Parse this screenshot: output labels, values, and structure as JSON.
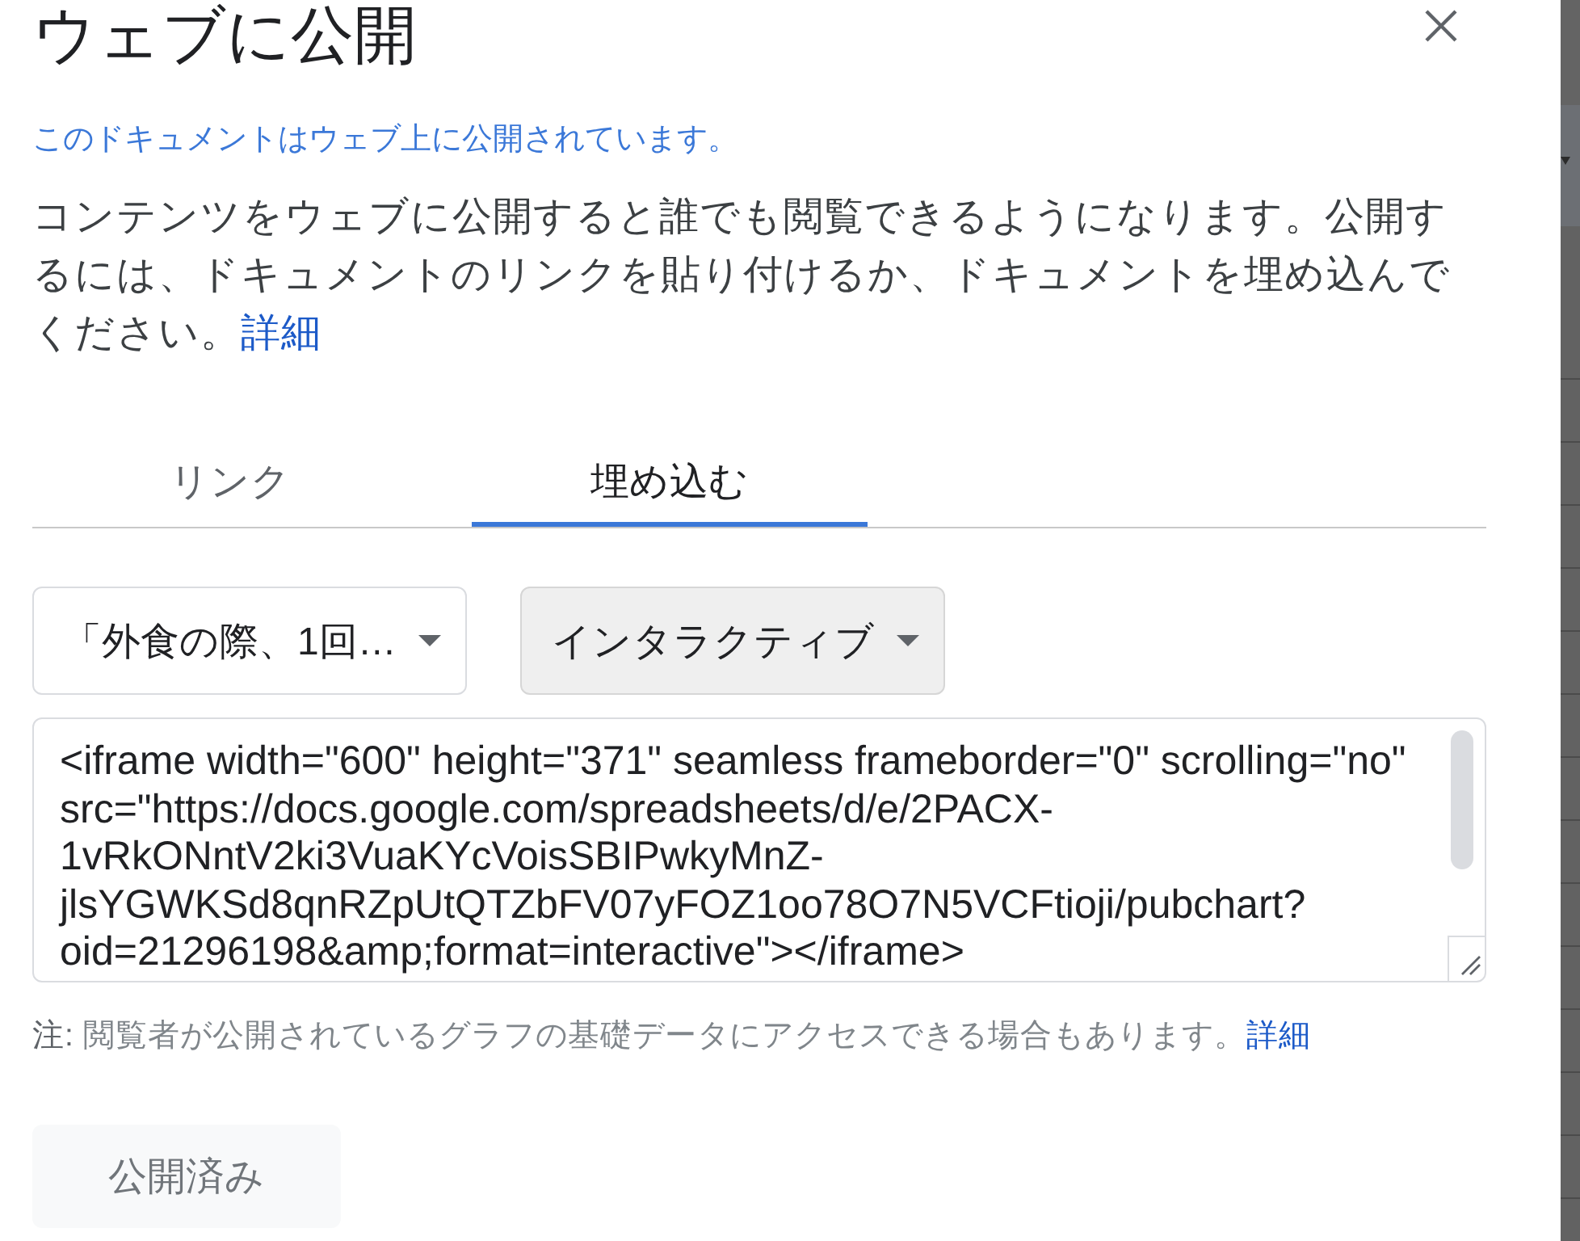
{
  "title": "ウェブに公開",
  "status": "このドキュメントはウェブ上に公開されています。",
  "description": {
    "text": "コンテンツをウェブに公開すると誰でも閲覧できるようになります。公開するには、ドキュメントのリンクを貼り付けるか、ドキュメントを埋め込んでください。",
    "link": "詳細"
  },
  "tabs": [
    {
      "label": "リンク",
      "selected": false
    },
    {
      "label": "埋め込む",
      "selected": true
    }
  ],
  "dropdowns": [
    {
      "value": "「外食の際、1回…",
      "hovered": false
    },
    {
      "value": "インタラクティブ",
      "hovered": true
    }
  ],
  "embed_code_field": {
    "value": "<iframe width=\"600\" height=\"371\" seamless frameborder=\"0\" scrolling=\"no\" src=\"https://docs.google.com/spreadsheets/d/e/2PACX-1vRkONntV2ki3VuaKYcVoisSBIPwkyMnZ-jlsYGWKSd8qnRZpUtQTZbFV07yFOZ1oo78O7N5VCFtioji/pubchart?oid=21296198&amp;format=interactive\"></iframe>"
  },
  "note": {
    "label": "注:",
    "text": "閲覧者が公開されているグラフの基礎データにアクセスできる場合もあります。",
    "link": "詳細"
  },
  "publish_button": {
    "label": "公開済み",
    "disabled": true
  }
}
